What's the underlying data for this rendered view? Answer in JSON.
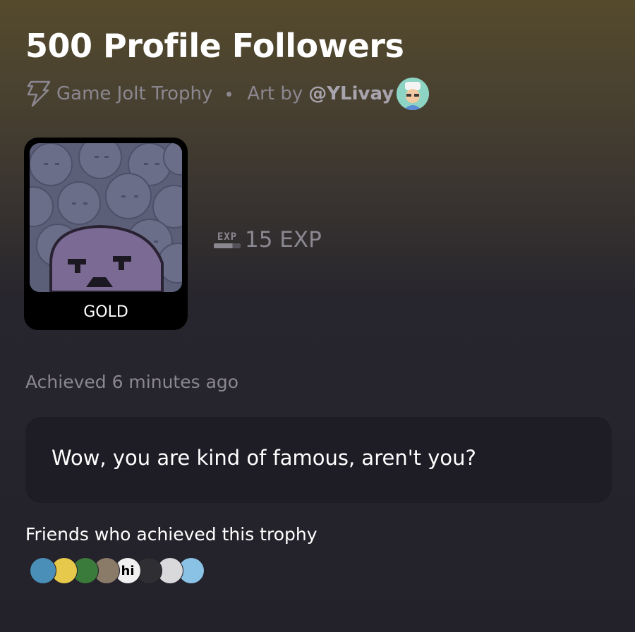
{
  "trophy": {
    "title": "500 Profile Followers",
    "type_label": "Game Jolt Trophy",
    "art_by_label": "Art by",
    "artist_handle": "@YLivay",
    "tier": "GOLD",
    "exp_icon_label": "EXP",
    "exp_value": "15 EXP",
    "achieved_text": "Achieved 6 minutes ago",
    "description": "Wow, you are kind of famous, aren't you?"
  },
  "friends": {
    "label": "Friends who achieved this trophy",
    "avatars": [
      {
        "icon": "avatar-shark",
        "color": "#4a8fb8"
      },
      {
        "icon": "avatar-sponge",
        "color": "#e6c84a"
      },
      {
        "icon": "avatar-green-monster",
        "color": "#3a7a3a"
      },
      {
        "icon": "avatar-person",
        "color": "#8a7a68"
      },
      {
        "icon": "avatar-hi",
        "color": "#f0f0f0",
        "text": "hi"
      },
      {
        "icon": "avatar-dark-character",
        "color": "#2e2e33"
      },
      {
        "icon": "avatar-red-white",
        "color": "#d9d9dc"
      },
      {
        "icon": "avatar-ice-blue",
        "color": "#8ac2e6"
      }
    ]
  },
  "colors": {
    "muted_text": "#8b8790",
    "description_bg": "#1e1c24",
    "page_bg": "#232129",
    "header_tint": "#554a2c"
  }
}
